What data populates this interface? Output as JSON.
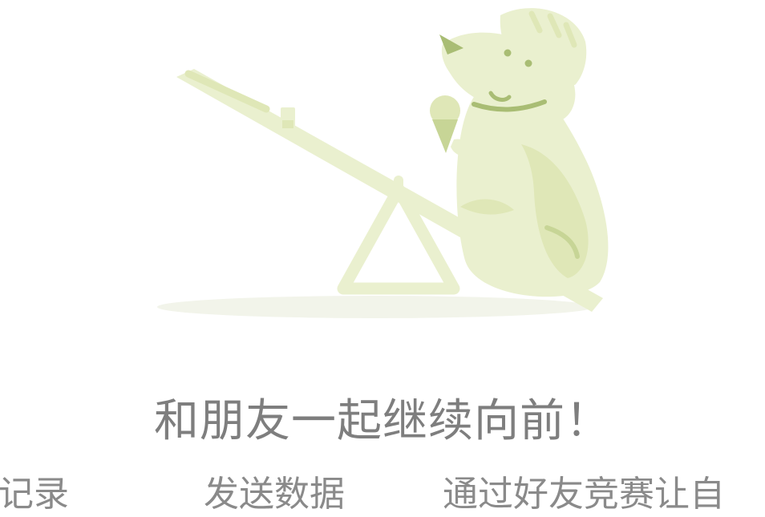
{
  "headline": "和朋友一起继续向前！",
  "subline_fragments": [
    "记录",
    "发送数据",
    "通过好友竞赛让自"
  ],
  "colors": {
    "illustration_light": "#eaf0cf",
    "illustration_mid": "#dfe7b7",
    "illustration_dark": "#a9bd74",
    "headline": "#7e7e7e",
    "subline": "#8a8a8a"
  },
  "icons": [
    "ice-cream-icon"
  ]
}
